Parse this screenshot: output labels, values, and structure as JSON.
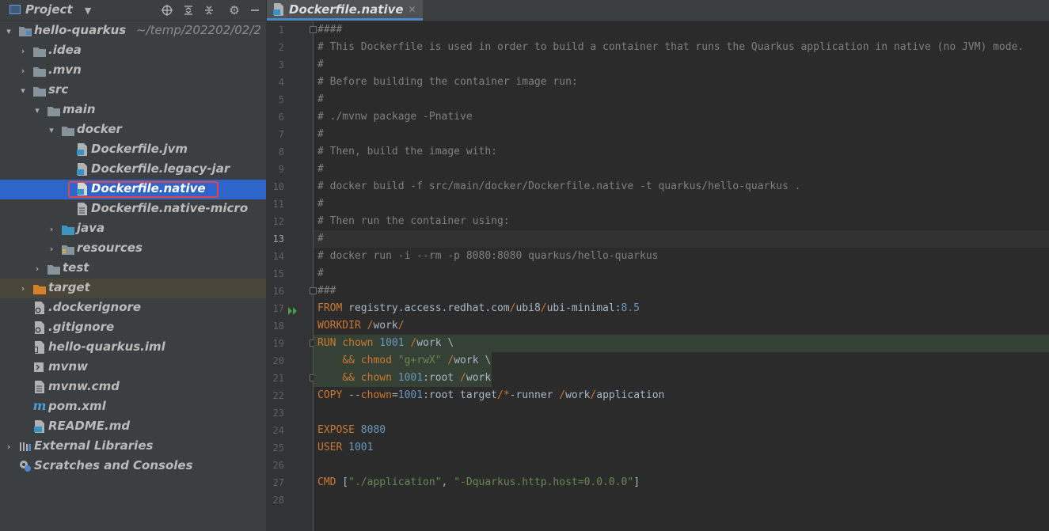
{
  "project_panel": {
    "title": "Project",
    "tree": [
      {
        "label": "hello-quarkus",
        "hint": "~/temp/202202/02/2"
      },
      {
        "label": ".idea"
      },
      {
        "label": ".mvn"
      },
      {
        "label": "src"
      },
      {
        "label": "main"
      },
      {
        "label": "docker"
      },
      {
        "label": "Dockerfile.jvm"
      },
      {
        "label": "Dockerfile.legacy-jar"
      },
      {
        "label": "Dockerfile.native"
      },
      {
        "label": "Dockerfile.native-micro"
      },
      {
        "label": "java"
      },
      {
        "label": "resources"
      },
      {
        "label": "test"
      },
      {
        "label": "target"
      },
      {
        "label": ".dockerignore"
      },
      {
        "label": ".gitignore"
      },
      {
        "label": "hello-quarkus.iml"
      },
      {
        "label": "mvnw"
      },
      {
        "label": "mvnw.cmd"
      },
      {
        "label": "pom.xml"
      },
      {
        "label": "README.md"
      },
      {
        "label": "External Libraries"
      },
      {
        "label": "Scratches and Consoles"
      }
    ]
  },
  "editor": {
    "tab_label": "Dockerfile.native",
    "line_numbers": [
      "1",
      "2",
      "3",
      "4",
      "5",
      "6",
      "7",
      "8",
      "9",
      "10",
      "11",
      "12",
      "13",
      "14",
      "15",
      "16",
      "17",
      "18",
      "19",
      "20",
      "21",
      "22",
      "23",
      "24",
      "25",
      "26",
      "27",
      "28"
    ],
    "lines": [
      "####",
      "# This Dockerfile is used in order to build a container that runs the Quarkus application in native (no JVM) mode.",
      "#",
      "# Before building the container image run:",
      "#",
      "# ./mvnw package -Pnative",
      "#",
      "# Then, build the image with:",
      "#",
      "# docker build -f src/main/docker/Dockerfile.native -t quarkus/hello-quarkus .",
      "#",
      "# Then run the container using:",
      "#",
      "# docker run -i --rm -p 8080:8080 quarkus/hello-quarkus",
      "#",
      "###",
      "FROM registry.access.redhat.com/ubi8/ubi-minimal:8.5",
      "WORKDIR /work/",
      "RUN chown 1001 /work \\",
      "    && chmod \"g+rwX\" /work \\",
      "    && chown 1001:root /work",
      "COPY --chown=1001:root target/*-runner /work/application",
      "",
      "EXPOSE 8080",
      "USER 1001",
      "",
      "CMD [\"./application\", \"-Dquarkus.http.host=0.0.0.0\"]",
      ""
    ],
    "current_line": "13"
  },
  "colors": {
    "panel_bg": "#3c3f41",
    "editor_bg": "#2b2b2b",
    "selection": "#2f65ca",
    "comment": "#808080",
    "keyword": "#cc7832",
    "string": "#6a8759",
    "number": "#6897bb",
    "highlight_box": "#e0454b"
  }
}
